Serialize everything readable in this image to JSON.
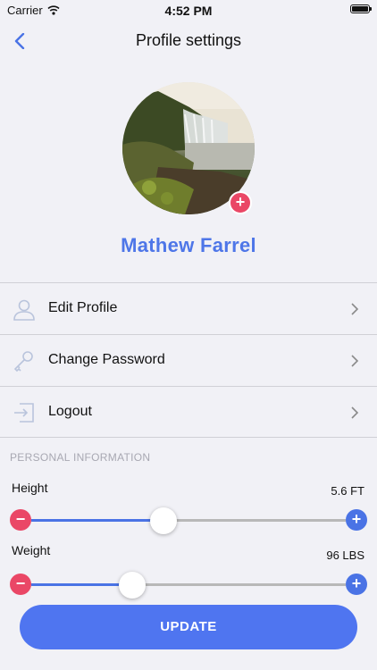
{
  "status_bar": {
    "carrier": "Carrier",
    "time": "4:52 PM"
  },
  "nav": {
    "title": "Profile settings"
  },
  "profile": {
    "name": "Mathew Farrel",
    "add_photo_glyph": "+"
  },
  "menu": [
    {
      "label": "Edit Profile",
      "icon": "user-icon"
    },
    {
      "label": "Change Password",
      "icon": "key-icon"
    },
    {
      "label": "Logout",
      "icon": "logout-icon"
    }
  ],
  "personal": {
    "header": "PERSONAL INFORMATION",
    "height": {
      "label": "Height",
      "value": "5.6 FT",
      "fraction": 0.42
    },
    "weight": {
      "label": "Weight",
      "value": "96 LBS",
      "fraction": 0.32
    }
  },
  "buttons": {
    "update": "UPDATE",
    "minus": "−",
    "plus": "+"
  },
  "colors": {
    "accent": "#4a73e5",
    "danger": "#ea4766",
    "name": "#4e76e8"
  }
}
